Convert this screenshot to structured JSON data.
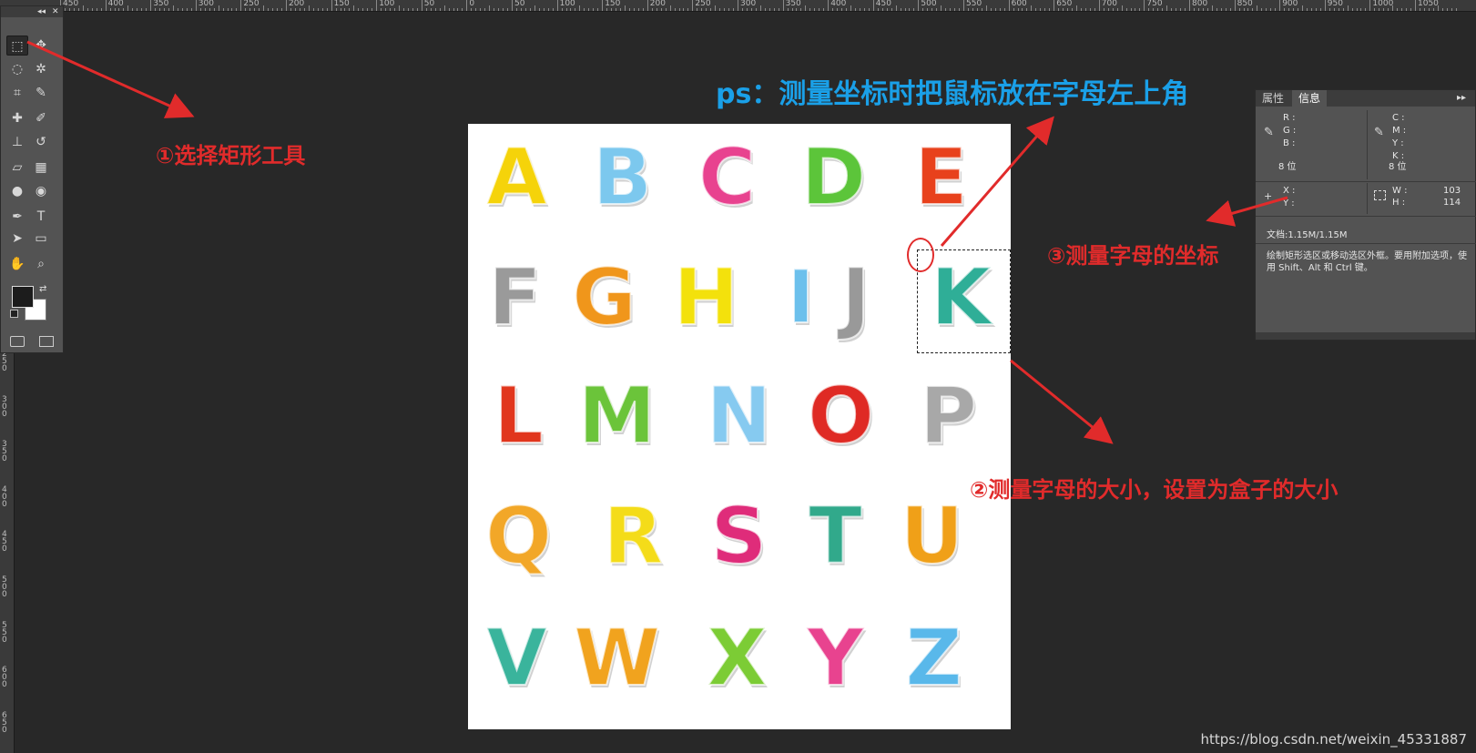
{
  "ruler_top_labels": [
    "450",
    "400",
    "350",
    "300",
    "250",
    "200",
    "150",
    "100",
    "50",
    "0",
    "50",
    "100",
    "150",
    "200",
    "250",
    "300",
    "350",
    "400",
    "450",
    "500",
    "550",
    "600",
    "650",
    "700",
    "750",
    "800",
    "850",
    "900",
    "950",
    "1000",
    "1050"
  ],
  "ruler_left_labels": [
    "250",
    "300",
    "350",
    "400",
    "450",
    "500",
    "550",
    "600",
    "650"
  ],
  "tools_panel": {
    "collapse_label": "◂◂",
    "close_label": "✕",
    "items": [
      {
        "name": "rect-marquee-icon",
        "glyph": "⬚"
      },
      {
        "name": "move-icon",
        "glyph": "✥"
      },
      {
        "name": "lasso-icon",
        "glyph": "◌"
      },
      {
        "name": "magic-wand-icon",
        "glyph": "✲"
      },
      {
        "name": "crop-icon",
        "glyph": "⌗"
      },
      {
        "name": "eyedropper-icon",
        "glyph": "✎"
      },
      {
        "name": "healing-brush-icon",
        "glyph": "✚"
      },
      {
        "name": "brush-icon",
        "glyph": "✐"
      },
      {
        "name": "stamp-icon",
        "glyph": "⊥"
      },
      {
        "name": "history-brush-icon",
        "glyph": "↺"
      },
      {
        "name": "eraser-icon",
        "glyph": "▱"
      },
      {
        "name": "gradient-icon",
        "glyph": "▦"
      },
      {
        "name": "blur-icon",
        "glyph": "●"
      },
      {
        "name": "dodge-icon",
        "glyph": "◉"
      },
      {
        "name": "pen-icon",
        "glyph": "✒"
      },
      {
        "name": "type-icon",
        "glyph": "T"
      },
      {
        "name": "path-select-icon",
        "glyph": "➤"
      },
      {
        "name": "shape-icon",
        "glyph": "▭"
      },
      {
        "name": "hand-icon",
        "glyph": "✋"
      },
      {
        "name": "zoom-icon",
        "glyph": "⌕"
      }
    ]
  },
  "colors": {
    "foreground": "#1c1c1c",
    "background": "#ffffff",
    "accent_red": "#e12b2b",
    "accent_blue": "#1aa0e8"
  },
  "canvas_letters": [
    {
      "char": "A",
      "color": "#f5d30a"
    },
    {
      "char": "B",
      "color": "#7cc8ee"
    },
    {
      "char": "C",
      "color": "#e8428f"
    },
    {
      "char": "D",
      "color": "#5cc53a"
    },
    {
      "char": "E",
      "color": "#e8411c"
    },
    {
      "char": "F",
      "color": "#9a9a9a"
    },
    {
      "char": "G",
      "color": "#f0961b"
    },
    {
      "char": "H",
      "color": "#f3e10c"
    },
    {
      "char": "I",
      "color": "#6cc0ec"
    },
    {
      "char": "J",
      "color": "#999999"
    },
    {
      "char": "K",
      "color": "#2fae97"
    },
    {
      "char": "L",
      "color": "#e1361d"
    },
    {
      "char": "M",
      "color": "#6bc43a"
    },
    {
      "char": "N",
      "color": "#86caf0"
    },
    {
      "char": "O",
      "color": "#df2a24"
    },
    {
      "char": "P",
      "color": "#a8a8a8"
    },
    {
      "char": "Q",
      "color": "#f2a728"
    },
    {
      "char": "R",
      "color": "#f4dc19"
    },
    {
      "char": "S",
      "color": "#df2c7a"
    },
    {
      "char": "T",
      "color": "#31a98b"
    },
    {
      "char": "U",
      "color": "#f0a018"
    },
    {
      "char": "V",
      "color": "#3ab49c"
    },
    {
      "char": "W",
      "color": "#f1a31e"
    },
    {
      "char": "X",
      "color": "#7ccc35"
    },
    {
      "char": "Y",
      "color": "#e8438f"
    },
    {
      "char": "Z",
      "color": "#59b8ea"
    }
  ],
  "info_panel": {
    "tab_properties": "属性",
    "tab_info": "信息",
    "menu_label": "▸▸",
    "rgb_labels": "R :\nG :\nB :",
    "cmyk_labels": "C :\nM :\nY :\nK :",
    "bit_depth_left": "8 位",
    "bit_depth_right": "8 位",
    "xy_labels": "X :\nY :",
    "w_label": "W :",
    "h_label": "H :",
    "w_value": "103",
    "h_value": "114",
    "doc_info": "文档:1.15M/1.15M",
    "hint": "绘制矩形选区或移动选区外框。要用附加选项，使用 Shift、Alt 和 Ctrl 键。"
  },
  "annotations": {
    "step1": "①选择矩形工具",
    "step2": "②测量字母的大小，设置为盒子的大小",
    "step3": "③测量字母的坐标",
    "tip": "ps：测量坐标时把鼠标放在字母左上角"
  },
  "watermark": "https://blog.csdn.net/weixin_45331887"
}
